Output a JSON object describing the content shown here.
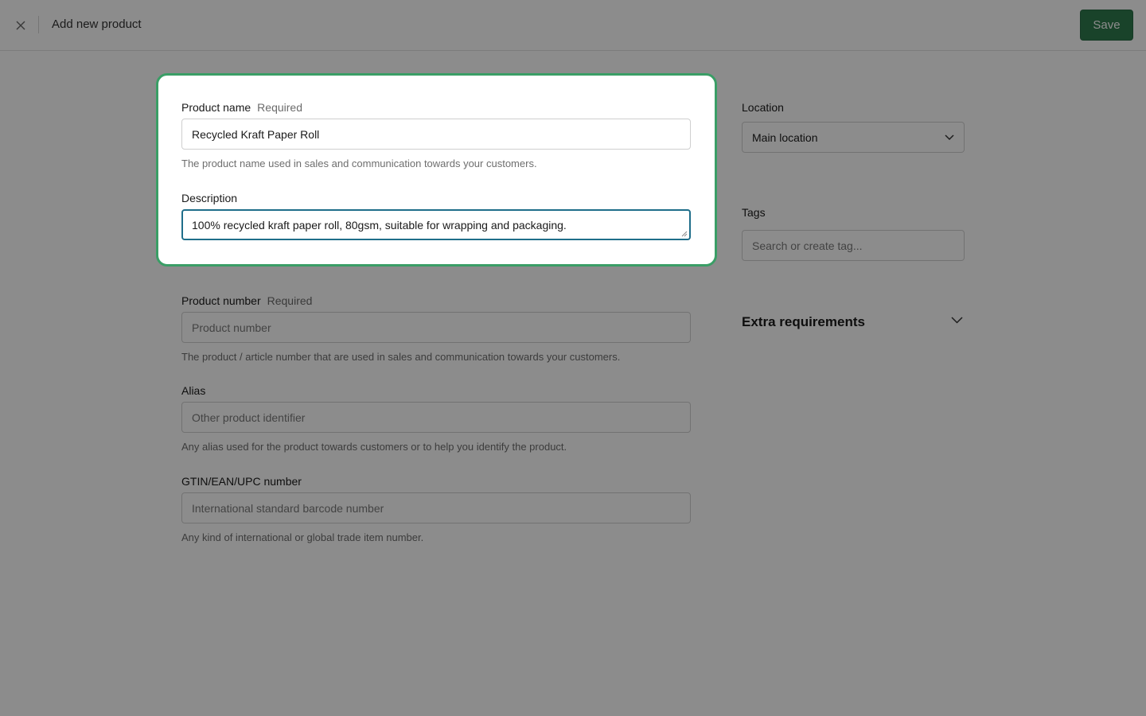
{
  "header": {
    "title": "Add new product",
    "save_label": "Save",
    "close_icon": "close-icon"
  },
  "product_name": {
    "label": "Product name",
    "required": "Required",
    "value": "Recycled Kraft Paper Roll",
    "hint": "The product name used in sales and communication towards your customers."
  },
  "description": {
    "label": "Description",
    "value": "100% recycled kraft paper roll, 80gsm, suitable for wrapping and packaging."
  },
  "product_number": {
    "label": "Product number",
    "required": "Required",
    "placeholder": "Product number",
    "hint": "The product / article number that are used in sales and communication towards your customers."
  },
  "alias": {
    "label": "Alias",
    "placeholder": "Other product identifier",
    "hint": "Any alias used for the product towards customers or to help you identify the product."
  },
  "gtin": {
    "label": "GTIN/EAN/UPC number",
    "placeholder": "International standard barcode number",
    "hint": "Any kind of international or global trade item number."
  },
  "location": {
    "label": "Location",
    "selected": "Main location"
  },
  "tags": {
    "label": "Tags",
    "placeholder": "Search or create tag..."
  },
  "extra": {
    "title": "Extra requirements"
  },
  "colors": {
    "accent": "#2f7a4e",
    "focus_ring": "#3a9e66",
    "active_input": "#1f6e8a"
  }
}
